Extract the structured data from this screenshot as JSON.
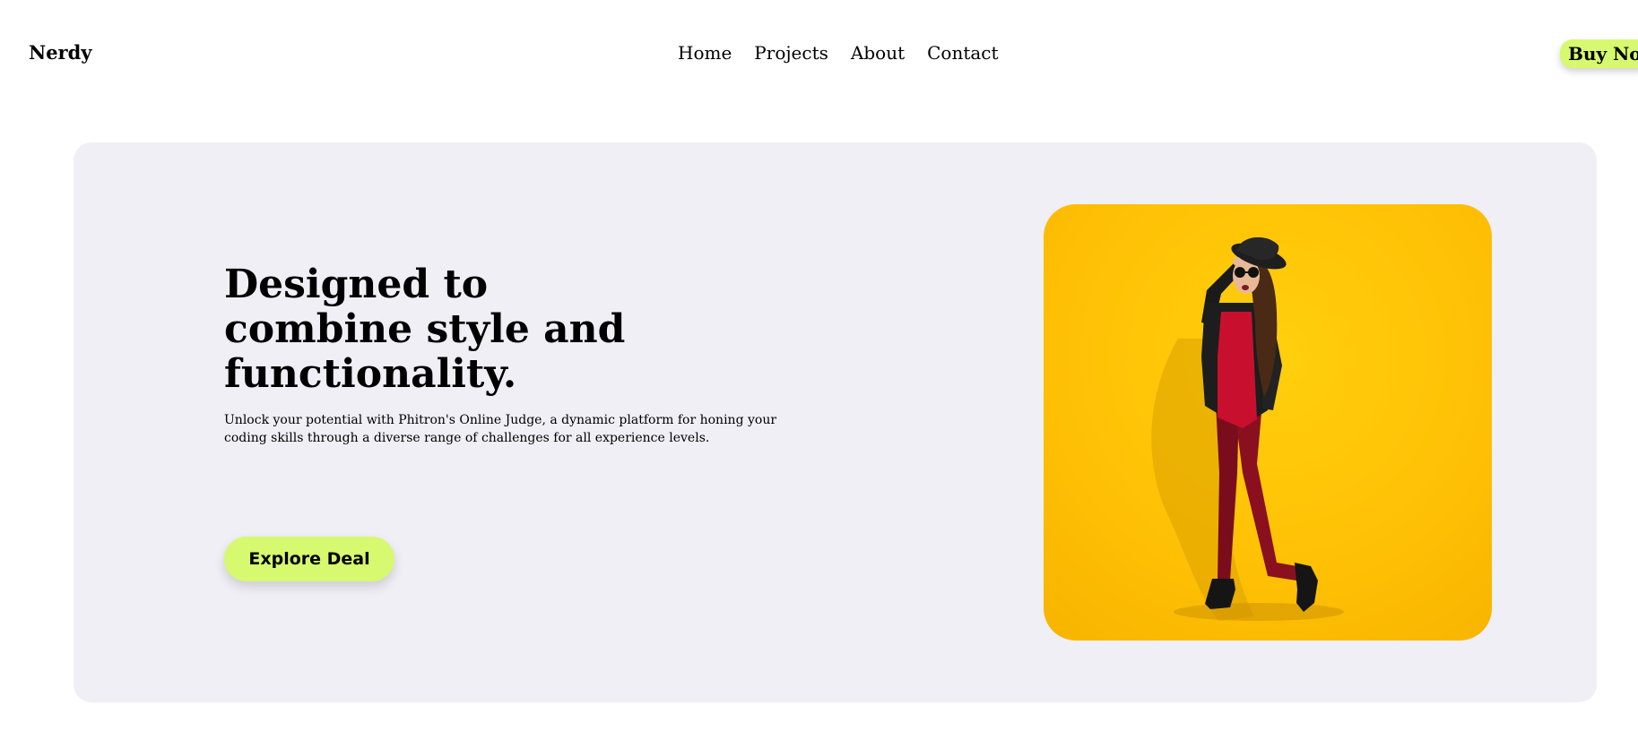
{
  "header": {
    "brand": "Nerdy",
    "nav": [
      "Home",
      "Projects",
      "About",
      "Contact"
    ],
    "cta_label": "Buy Now"
  },
  "hero": {
    "title": "Designed to combine style and functionality.",
    "description": "Unlock your potential with Phitron's Online Judge, a dynamic platform for honing your coding skills through a diverse range of challenges for all experience levels.",
    "button_label": "Explore Deal"
  },
  "colors": {
    "accent": "#d7f96f",
    "hero_background": "#efeff5",
    "image_background": "#ffc107"
  }
}
